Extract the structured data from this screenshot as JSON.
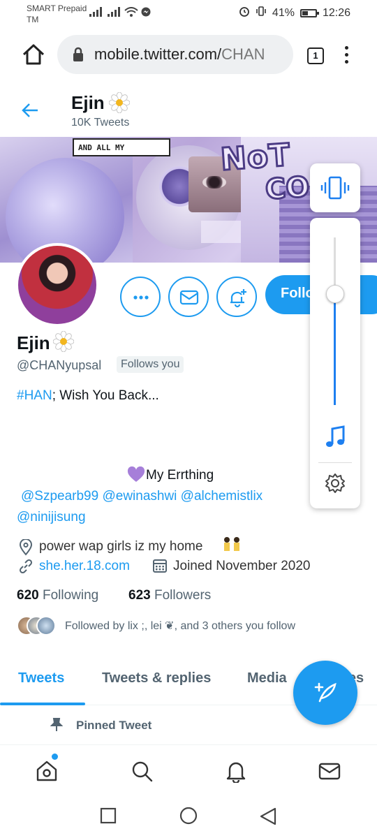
{
  "status_bar": {
    "carrier": "SMART Prepaid TM",
    "battery": "41%",
    "time": "12:26"
  },
  "browser": {
    "url_main": "mobile.twitter.com/",
    "url_dim": "CHAN",
    "tab_count": "1"
  },
  "profile_header": {
    "name": "Ejin",
    "tweet_count": "10K Tweets"
  },
  "banner": {
    "pixel_text": "AND ALL MY",
    "word1": "NoT",
    "word2": "COo"
  },
  "actions": {
    "follow_label": "Follow"
  },
  "profile": {
    "display_name": "Ejin",
    "handle": "@CHANyupsal",
    "follows_you": "Follows you",
    "bio_hashtag": "#HAN",
    "bio_rest": "; Wish You Back...",
    "bio_heart_line": "My Errthing",
    "mentions_line1": "@Szpearb99 @ewinashwi @alchemistlix",
    "mentions_line2": "@ninijisung",
    "location": "power wap girls iz my home",
    "website": "she.her.18.com",
    "joined": "Joined November 2020",
    "following_count": "620",
    "following_label": "Following",
    "followers_count": "623",
    "followers_label": "Followers",
    "followed_by": "Followed by lix ;, lei ❦, and 3 others you follow"
  },
  "tabs": [
    {
      "label": "Tweets"
    },
    {
      "label": "Tweets & replies"
    },
    {
      "label": "Media"
    },
    {
      "label": "Likes"
    }
  ],
  "pinned": {
    "label": "Pinned Tweet"
  },
  "colors": {
    "accent": "#1d9bf0",
    "text": "#0f1419",
    "muted": "#536471"
  }
}
